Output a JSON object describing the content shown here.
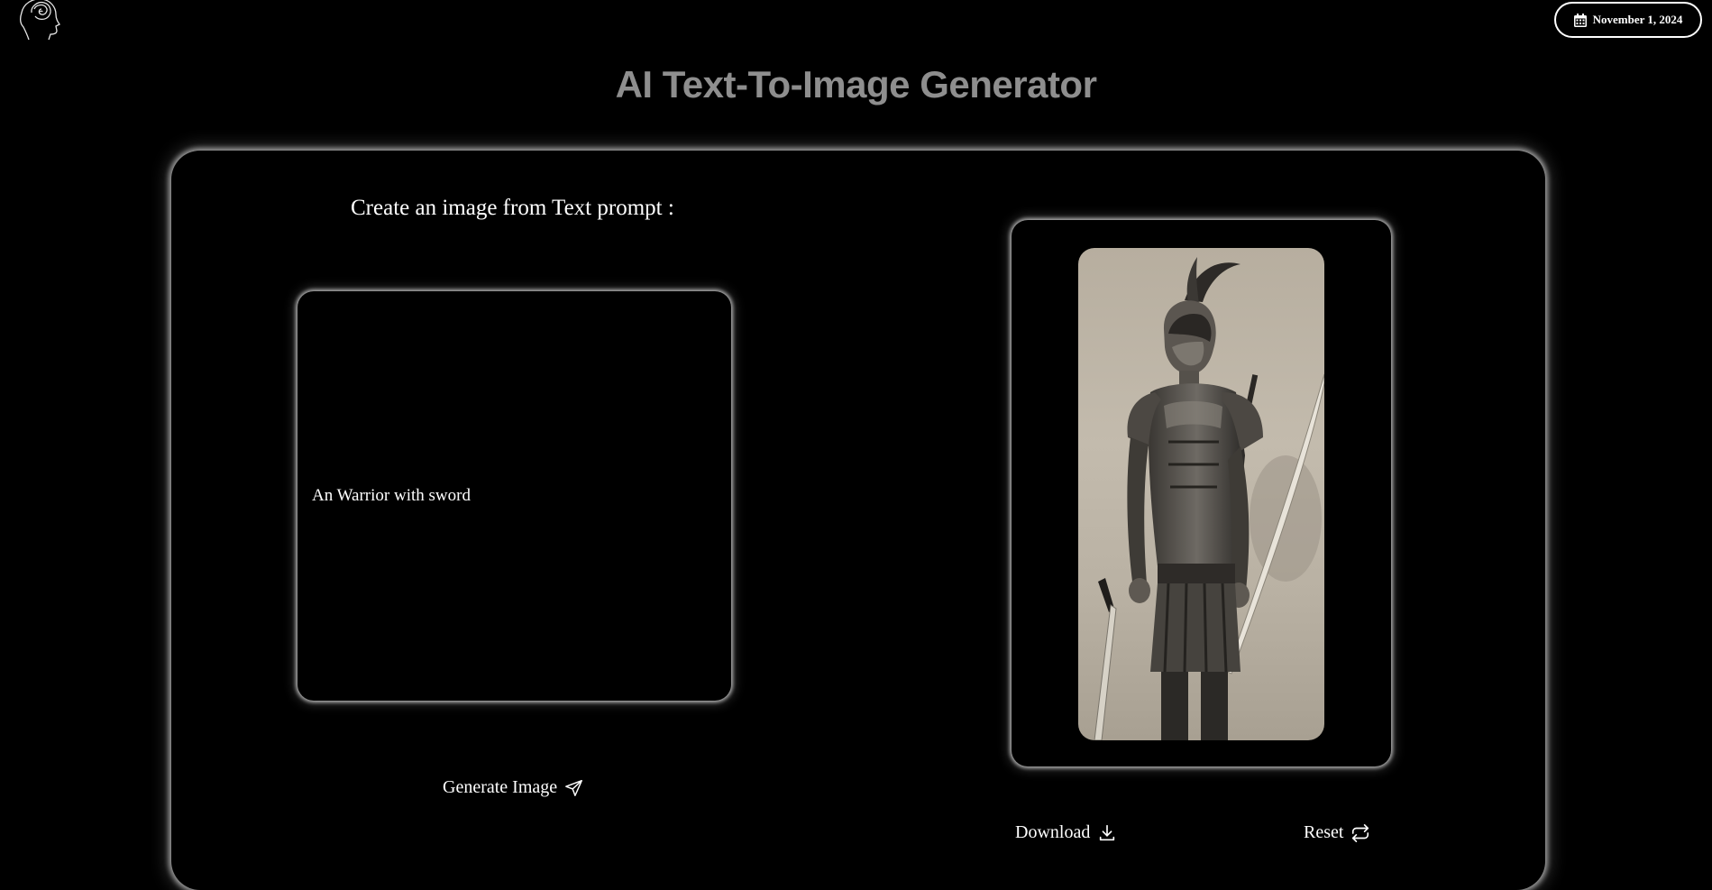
{
  "header": {
    "date": "November 1, 2024",
    "logo_icon": "head-silhouette-logo-icon",
    "date_icon": "calendar-icon"
  },
  "page_title": "AI Text-To-Image Generator",
  "prompt_section": {
    "heading": "Create an image from Text prompt :",
    "prompt_text": "An Warrior with sword",
    "generate_label": "Generate Image",
    "generate_icon": "send-icon"
  },
  "result_section": {
    "image_subject": "warrior-illustration",
    "download_label": "Download",
    "download_icon": "download-icon",
    "reset_label": "Reset",
    "reset_icon": "refresh-icon"
  },
  "colors": {
    "background": "#000000",
    "title": "#8e8e8e",
    "text": "#ffffff",
    "glow": "#ffffff"
  }
}
